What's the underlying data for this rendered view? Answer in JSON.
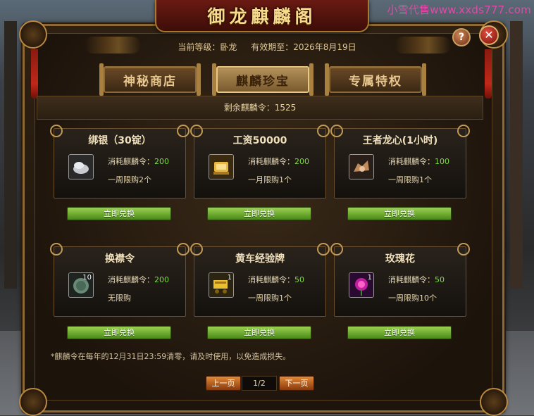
{
  "watermark": "小雪代售www.xxds777.com",
  "window": {
    "title": "御龙麒麟阁"
  },
  "header": {
    "level_label": "当前等级：卧龙",
    "expiry_label": "有效期至：2026年8月19日"
  },
  "tabs": [
    {
      "label": "神秘商店",
      "active": false
    },
    {
      "label": "麒麟珍宝",
      "active": true
    },
    {
      "label": "专属特权",
      "active": false
    }
  ],
  "remaining_tokens": "剩余麒麟令：1525",
  "items": [
    {
      "name": "绑银（30锭）",
      "cost_label": "消耗麒麟令：",
      "cost_value": "200",
      "limit": "一周限购2个",
      "icon": "silver-ingot-icon",
      "qty": "",
      "button": "立即兑换"
    },
    {
      "name": "工资50000",
      "cost_label": "消耗麒麟令：",
      "cost_value": "200",
      "limit": "一月限购1个",
      "icon": "gold-scroll-icon",
      "qty": "",
      "button": "立即兑换"
    },
    {
      "name": "王者龙心(1小时)",
      "cost_label": "消耗麒麟令：",
      "cost_value": "100",
      "limit": "一周限购1个",
      "icon": "dragon-heart-icon",
      "qty": "",
      "button": "立即兑换"
    },
    {
      "name": "换襟令",
      "cost_label": "消耗麒麟令：",
      "cost_value": "200",
      "limit": "无限购",
      "icon": "token-coin-icon",
      "qty": "10",
      "button": "立即兑换"
    },
    {
      "name": "黄车经验牌",
      "cost_label": "消耗麒麟令：",
      "cost_value": "50",
      "limit": "一周限购1个",
      "icon": "yellow-cart-icon",
      "qty": "1",
      "button": "立即兑换"
    },
    {
      "name": "玫瑰花",
      "cost_label": "消耗麒麟令：",
      "cost_value": "50",
      "limit": "一周限购10个",
      "icon": "rose-icon",
      "qty": "1",
      "button": "立即兑换"
    }
  ],
  "note": "*麒麟令在每年的12月31日23:59清零，请及时使用，以免造成损失。",
  "pager": {
    "prev": "上一页",
    "page": "1/2",
    "next": "下一页"
  },
  "controls": {
    "help": "?",
    "close": "✕"
  }
}
